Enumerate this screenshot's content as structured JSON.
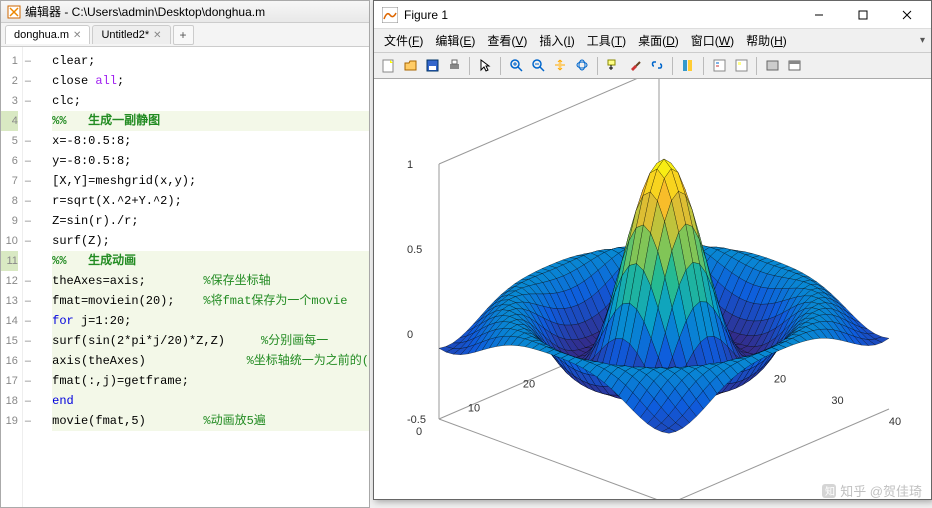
{
  "editor": {
    "title": "编辑器 - C:\\Users\\admin\\Desktop\\donghua.m",
    "tabs": [
      {
        "label": "donghua.m",
        "modified": false
      },
      {
        "label": "Untitled2*",
        "modified": true
      }
    ],
    "add_tab": "+",
    "lines": [
      {
        "n": 1,
        "mark": "–",
        "code": [
          {
            "t": "clear",
            "c": ""
          },
          {
            "t": ";",
            "c": ""
          }
        ]
      },
      {
        "n": 2,
        "mark": "–",
        "code": [
          {
            "t": "close ",
            "c": ""
          },
          {
            "t": "all",
            "c": "str"
          },
          {
            "t": ";",
            "c": ""
          }
        ]
      },
      {
        "n": 3,
        "mark": "–",
        "code": [
          {
            "t": "clc;",
            "c": ""
          }
        ]
      },
      {
        "n": 4,
        "mark": "",
        "section": true,
        "code": [
          {
            "t": "%%   生成一副静图",
            "c": "sec"
          }
        ]
      },
      {
        "n": 5,
        "mark": "–",
        "code": [
          {
            "t": "x=-8:0.5:8;",
            "c": ""
          }
        ]
      },
      {
        "n": 6,
        "mark": "–",
        "code": [
          {
            "t": "y=-8:0.5:8;",
            "c": ""
          }
        ]
      },
      {
        "n": 7,
        "mark": "–",
        "code": [
          {
            "t": "[X,Y]=meshgrid(x,y);",
            "c": ""
          }
        ]
      },
      {
        "n": 8,
        "mark": "–",
        "code": [
          {
            "t": "r=sqrt(X.^2+Y.^2);",
            "c": ""
          }
        ]
      },
      {
        "n": 9,
        "mark": "–",
        "code": [
          {
            "t": "Z=sin(r)./r;",
            "c": ""
          }
        ]
      },
      {
        "n": 10,
        "mark": "–",
        "code": [
          {
            "t": "surf(Z);",
            "c": ""
          }
        ]
      },
      {
        "n": 11,
        "mark": "",
        "section": true,
        "code": [
          {
            "t": "%%   生成动画",
            "c": "sec"
          }
        ]
      },
      {
        "n": 12,
        "mark": "–",
        "section": true,
        "code": [
          {
            "t": "theAxes=axis;        ",
            "c": ""
          },
          {
            "t": "%保存坐标轴",
            "c": "com"
          }
        ]
      },
      {
        "n": 13,
        "mark": "–",
        "section": true,
        "code": [
          {
            "t": "fmat=moviein(20);    ",
            "c": ""
          },
          {
            "t": "%将fmat保存为一个movie",
            "c": "com"
          }
        ]
      },
      {
        "n": 14,
        "mark": "–",
        "section": true,
        "fold": "⊟",
        "code": [
          {
            "t": "for ",
            "c": "kw"
          },
          {
            "t": "j=1:20;",
            "c": ""
          }
        ]
      },
      {
        "n": 15,
        "mark": "–",
        "section": true,
        "code": [
          {
            "t": "surf(sin(2*pi*j/20)*Z,Z)     ",
            "c": ""
          },
          {
            "t": "%分别画每一",
            "c": "com"
          }
        ]
      },
      {
        "n": 16,
        "mark": "–",
        "section": true,
        "code": [
          {
            "t": "axis(theAxes)              ",
            "c": ""
          },
          {
            "t": "%坐标轴统一为之前的(",
            "c": "com"
          }
        ]
      },
      {
        "n": 17,
        "mark": "–",
        "section": true,
        "code": [
          {
            "t": "fmat(:,j)=getframe;",
            "c": ""
          }
        ]
      },
      {
        "n": 18,
        "mark": "–",
        "section": true,
        "code": [
          {
            "t": "end",
            "c": "kw"
          }
        ]
      },
      {
        "n": 19,
        "mark": "–",
        "section": true,
        "code": [
          {
            "t": "movie(fmat,5)        ",
            "c": ""
          },
          {
            "t": "%动画放5遍",
            "c": "com"
          }
        ]
      }
    ]
  },
  "figure": {
    "title": "Figure 1",
    "menu": [
      {
        "label": "文件",
        "key": "F"
      },
      {
        "label": "编辑",
        "key": "E"
      },
      {
        "label": "查看",
        "key": "V"
      },
      {
        "label": "插入",
        "key": "I"
      },
      {
        "label": "工具",
        "key": "T"
      },
      {
        "label": "桌面",
        "key": "D"
      },
      {
        "label": "窗口",
        "key": "W"
      },
      {
        "label": "帮助",
        "key": "H"
      }
    ],
    "toolbar_icons": [
      "new-icon",
      "open-icon",
      "save-icon",
      "print-icon",
      "sep",
      "pointer-icon",
      "sep",
      "zoom-in-icon",
      "zoom-out-icon",
      "pan-icon",
      "rotate3d-icon",
      "sep",
      "datacursor-icon",
      "brush-icon",
      "link-icon",
      "sep",
      "colorbar-icon",
      "sep",
      "legend-icon",
      "annotate-icon",
      "sep",
      "hide-icon",
      "dock-icon"
    ]
  },
  "chart_data": {
    "type": "surface3d",
    "x_range": [
      0,
      40
    ],
    "y_range": [
      0,
      40
    ],
    "z_range": [
      -0.5,
      1
    ],
    "x_ticks": [
      0,
      10,
      20,
      30,
      40
    ],
    "y_ticks": [
      0,
      10,
      20,
      30,
      40
    ],
    "z_ticks": [
      -0.5,
      0,
      0.5,
      1
    ],
    "formula": "Z = sin(sqrt(X^2+Y^2)) / sqrt(X^2+Y^2)",
    "grid_step": 0.5,
    "domain": [
      -8,
      8
    ],
    "z_peak": 1.0,
    "z_trough": -0.22,
    "colormap": "parula"
  },
  "watermark": "知乎 @贺佳琦"
}
